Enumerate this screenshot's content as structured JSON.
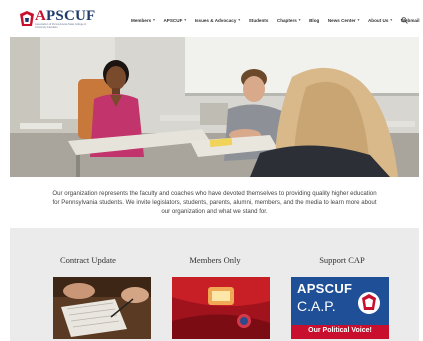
{
  "brand": {
    "name_prefix": "",
    "name_a": "A",
    "name_rest": "PSCUF",
    "tagline": "Association of Pennsylvania State College & University Faculties"
  },
  "nav": {
    "items": [
      {
        "label": "Members",
        "has_dropdown": true
      },
      {
        "label": "APSCUF",
        "has_dropdown": true
      },
      {
        "label": "Issues & Advocacy",
        "has_dropdown": true
      },
      {
        "label": "Students",
        "has_dropdown": false
      },
      {
        "label": "Chapters",
        "has_dropdown": true
      },
      {
        "label": "Blog",
        "has_dropdown": false
      },
      {
        "label": "News Center",
        "has_dropdown": true
      },
      {
        "label": "About Us",
        "has_dropdown": true
      },
      {
        "label": "Webmail",
        "has_dropdown": false
      }
    ],
    "search_icon": "search-icon"
  },
  "intro": {
    "text": "Our organization represents the faculty and coaches who have devoted themselves to providing quality higher education for Pennsylvania students. We invite legislators, students, parents, alumni, members, and the media to learn more about our organization and what we stand for."
  },
  "cards": [
    {
      "title": "Contract Update"
    },
    {
      "title": "Members Only"
    },
    {
      "title": "Support CAP"
    }
  ],
  "cap_graphic": {
    "line1": "APSCUF",
    "line2": "C.A.P.",
    "slogan": "Our Political Voice!"
  },
  "colors": {
    "brand_navy": "#1f3b6b",
    "brand_red": "#c8102e",
    "band_gray": "#ebebeb"
  }
}
